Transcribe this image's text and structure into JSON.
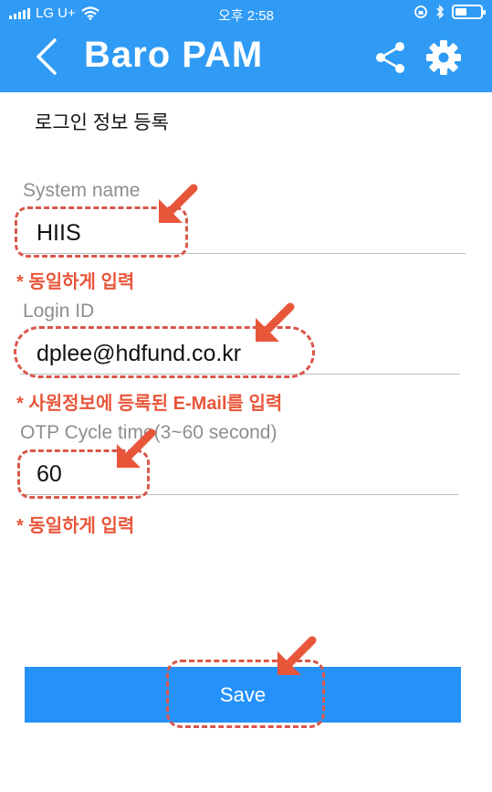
{
  "status_bar": {
    "carrier": "LG U+",
    "time": "오후 2:58"
  },
  "app_bar": {
    "title": "Baro PAM",
    "icons": [
      "back-icon",
      "share-icon",
      "gear-icon"
    ],
    "color": "#2f9bf5"
  },
  "page": {
    "section_title": "로그인 정보 등록"
  },
  "form": {
    "system_name": {
      "label": "System name",
      "value": "HIIS"
    },
    "login_id": {
      "label": "Login ID",
      "value": "dplee@hdfund.co.kr"
    },
    "otp_cycle": {
      "label": "OTP Cycle time(3~60 second)",
      "value": "60"
    }
  },
  "annotations": {
    "hint_system": "* 동일하게 입력",
    "hint_login": "* 사원정보에 등록된 E-Mail를 입력",
    "hint_otp": "* 동일하게 입력",
    "color": "#e8563a"
  },
  "actions": {
    "save_label": "Save",
    "save_color": "#2592fb"
  }
}
